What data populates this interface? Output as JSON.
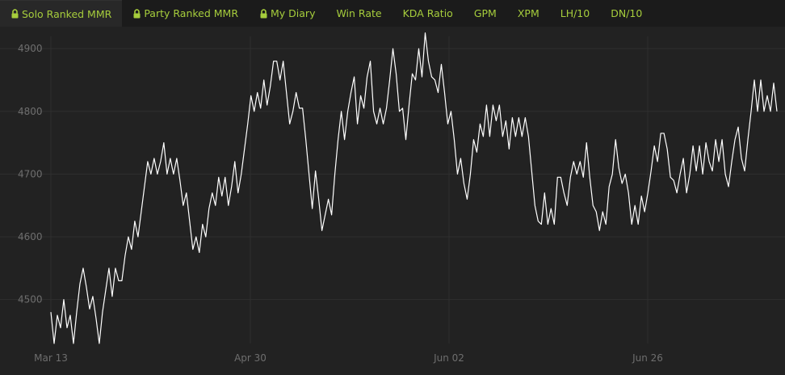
{
  "tabs": [
    {
      "label": "Solo Ranked MMR",
      "locked": true,
      "active": true
    },
    {
      "label": "Party Ranked MMR",
      "locked": true,
      "active": false
    },
    {
      "label": "My Diary",
      "locked": true,
      "active": false
    },
    {
      "label": "Win Rate",
      "locked": false,
      "active": false
    },
    {
      "label": "KDA Ratio",
      "locked": false,
      "active": false
    },
    {
      "label": "GPM",
      "locked": false,
      "active": false
    },
    {
      "label": "XPM",
      "locked": false,
      "active": false
    },
    {
      "label": "LH/10",
      "locked": false,
      "active": false
    },
    {
      "label": "DN/10",
      "locked": false,
      "active": false
    }
  ],
  "colors": {
    "accent": "#a6cd3c",
    "background": "#222222",
    "line": "#ffffff",
    "grid": "#2f2f2f",
    "tick_label": "#6e6e6e"
  },
  "chart_data": {
    "type": "line",
    "title": "",
    "xlabel": "",
    "ylabel": "",
    "grid": true,
    "ylim": [
      4430,
      4935
    ],
    "yticks": [
      4500,
      4600,
      4700,
      4800,
      4900
    ],
    "xtick_labels": [
      "Mar 13",
      "Apr 30",
      "Jun 02",
      "Jun 26"
    ],
    "series": [
      {
        "values": [
          4480,
          4430,
          4475,
          4455,
          4500,
          4455,
          4475,
          4430,
          4480,
          4525,
          4550,
          4520,
          4485,
          4505,
          4470,
          4430,
          4480,
          4515,
          4550,
          4505,
          4550,
          4530,
          4530,
          4570,
          4600,
          4580,
          4625,
          4600,
          4640,
          4680,
          4720,
          4700,
          4725,
          4700,
          4720,
          4750,
          4700,
          4725,
          4700,
          4725,
          4690,
          4650,
          4670,
          4625,
          4580,
          4600,
          4575,
          4620,
          4600,
          4645,
          4670,
          4650,
          4695,
          4665,
          4695,
          4650,
          4680,
          4720,
          4670,
          4700,
          4740,
          4780,
          4825,
          4800,
          4830,
          4805,
          4850,
          4810,
          4840,
          4880,
          4880,
          4850,
          4880,
          4830,
          4780,
          4800,
          4830,
          4805,
          4805,
          4755,
          4700,
          4645,
          4705,
          4660,
          4610,
          4635,
          4660,
          4635,
          4700,
          4755,
          4800,
          4755,
          4800,
          4830,
          4855,
          4780,
          4825,
          4805,
          4855,
          4880,
          4800,
          4780,
          4805,
          4780,
          4805,
          4850,
          4900,
          4860,
          4800,
          4805,
          4755,
          4810,
          4860,
          4850,
          4900,
          4855,
          4925,
          4880,
          4855,
          4850,
          4830,
          4875,
          4830,
          4780,
          4800,
          4755,
          4700,
          4725,
          4685,
          4660,
          4700,
          4755,
          4735,
          4780,
          4760,
          4810,
          4760,
          4810,
          4785,
          4810,
          4760,
          4785,
          4740,
          4790,
          4760,
          4790,
          4760,
          4790,
          4760,
          4705,
          4650,
          4625,
          4620,
          4670,
          4620,
          4645,
          4620,
          4695,
          4695,
          4670,
          4650,
          4695,
          4720,
          4700,
          4720,
          4695,
          4750,
          4695,
          4650,
          4640,
          4610,
          4640,
          4620,
          4680,
          4700,
          4755,
          4710,
          4685,
          4700,
          4670,
          4620,
          4650,
          4620,
          4665,
          4640,
          4670,
          4705,
          4745,
          4720,
          4765,
          4765,
          4740,
          4695,
          4690,
          4670,
          4700,
          4725,
          4670,
          4700,
          4745,
          4705,
          4745,
          4700,
          4750,
          4720,
          4705,
          4755,
          4720,
          4755,
          4700,
          4680,
          4720,
          4755,
          4775,
          4725,
          4705,
          4755,
          4800,
          4850,
          4800,
          4850,
          4800,
          4825,
          4800,
          4845,
          4800
        ],
        "color": "#ffffff"
      }
    ]
  }
}
